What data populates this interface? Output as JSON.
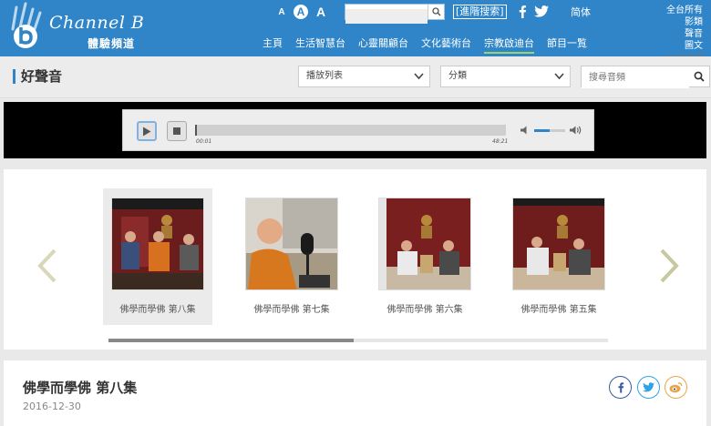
{
  "header": {
    "logo_title": "Channel B",
    "logo_subtitle": "體驗頻道",
    "font_sizes": [
      "A",
      "A",
      "A"
    ],
    "search_placeholder": "",
    "advanced_search": "[進階搜索]",
    "simplified": "简体",
    "side_links": [
      "全台所有",
      "影類",
      "聲音",
      "圖文"
    ],
    "nav": [
      {
        "label": "主頁",
        "active": false
      },
      {
        "label": "生活智慧台",
        "active": false
      },
      {
        "label": "心靈關顧台",
        "active": false
      },
      {
        "label": "文化藝術台",
        "active": false
      },
      {
        "label": "宗教啟迪台",
        "active": true
      },
      {
        "label": "節目一覧",
        "active": false
      }
    ],
    "faint_link": "全台所有影類",
    "accent_color": "#2f85c8"
  },
  "toolbar": {
    "page_title": "好聲音",
    "playlist_select": "播放列表",
    "category_select": "分類",
    "search_audio_placeholder": "搜尋音頻"
  },
  "player": {
    "current_time": "00:01",
    "total_time": "48:21",
    "progress_fraction": 0.005,
    "volume_fraction": 0.5
  },
  "carousel": {
    "episodes": [
      {
        "label": "佛學而學佛 第八集",
        "selected": true
      },
      {
        "label": "佛學而學佛 第七集",
        "selected": false
      },
      {
        "label": "佛學而學佛 第六集",
        "selected": false
      },
      {
        "label": "佛學而學佛 第五集",
        "selected": false
      }
    ],
    "scroll_fraction": 0.49
  },
  "details": {
    "title": "佛學而學佛 第八集",
    "date": "2016-12-30",
    "share_icons": [
      "facebook-icon",
      "twitter-icon",
      "weibo-icon"
    ]
  }
}
